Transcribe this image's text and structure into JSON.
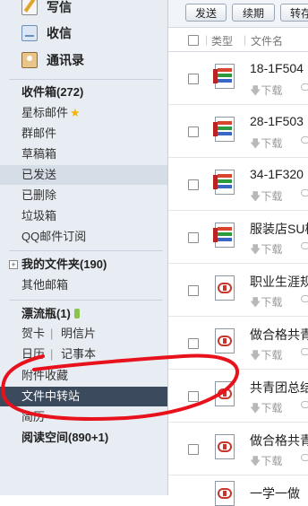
{
  "sidebar": {
    "top": [
      {
        "label": "写信",
        "icon": "compose-icon"
      },
      {
        "label": "收信",
        "icon": "inbox-icon"
      },
      {
        "label": "通讯录",
        "icon": "contacts-icon"
      }
    ],
    "inbox": "收件箱(272)",
    "starred": "星标邮件",
    "group": "群邮件",
    "drafts": "草稿箱",
    "sent": "已发送",
    "deleted": "已删除",
    "spam": "垃圾箱",
    "subscribe": "QQ邮件订阅",
    "my_folders": "我的文件夹(190)",
    "other_mailbox": "其他邮箱",
    "bottle": "漂流瓶(1)",
    "greeting_card": "贺卡",
    "postcard": "明信片",
    "calendar": "日历",
    "notebook": "记事本",
    "attachments": "附件收藏",
    "file_transfer": "文件中转站",
    "resume": "简历",
    "reading_space": "阅读空间(890+1)",
    "separator": "|"
  },
  "toolbar": {
    "send": "发送",
    "renew": "续期",
    "forward": "转存"
  },
  "list_header": {
    "type": "类型",
    "filename": "文件名"
  },
  "files": [
    {
      "name": "18-1F504",
      "type": "xlsx",
      "download": "下载"
    },
    {
      "name": "28-1F503",
      "type": "xlsx",
      "download": "下载"
    },
    {
      "name": "34-1F320",
      "type": "xlsx",
      "download": "下载"
    },
    {
      "name": "服装店SU模",
      "type": "xlsx",
      "download": "下载"
    },
    {
      "name": "职业生涯规",
      "type": "ppt",
      "download": "下载"
    },
    {
      "name": "做合格共青",
      "type": "ppt",
      "download": "下载"
    },
    {
      "name": "共青团总结",
      "type": "ppt",
      "download": "下载"
    },
    {
      "name": "做合格共青",
      "type": "ppt",
      "download": "下载"
    },
    {
      "name": "一学一做",
      "type": "ppt",
      "download": ""
    }
  ],
  "annotation_color": "#e8121c"
}
